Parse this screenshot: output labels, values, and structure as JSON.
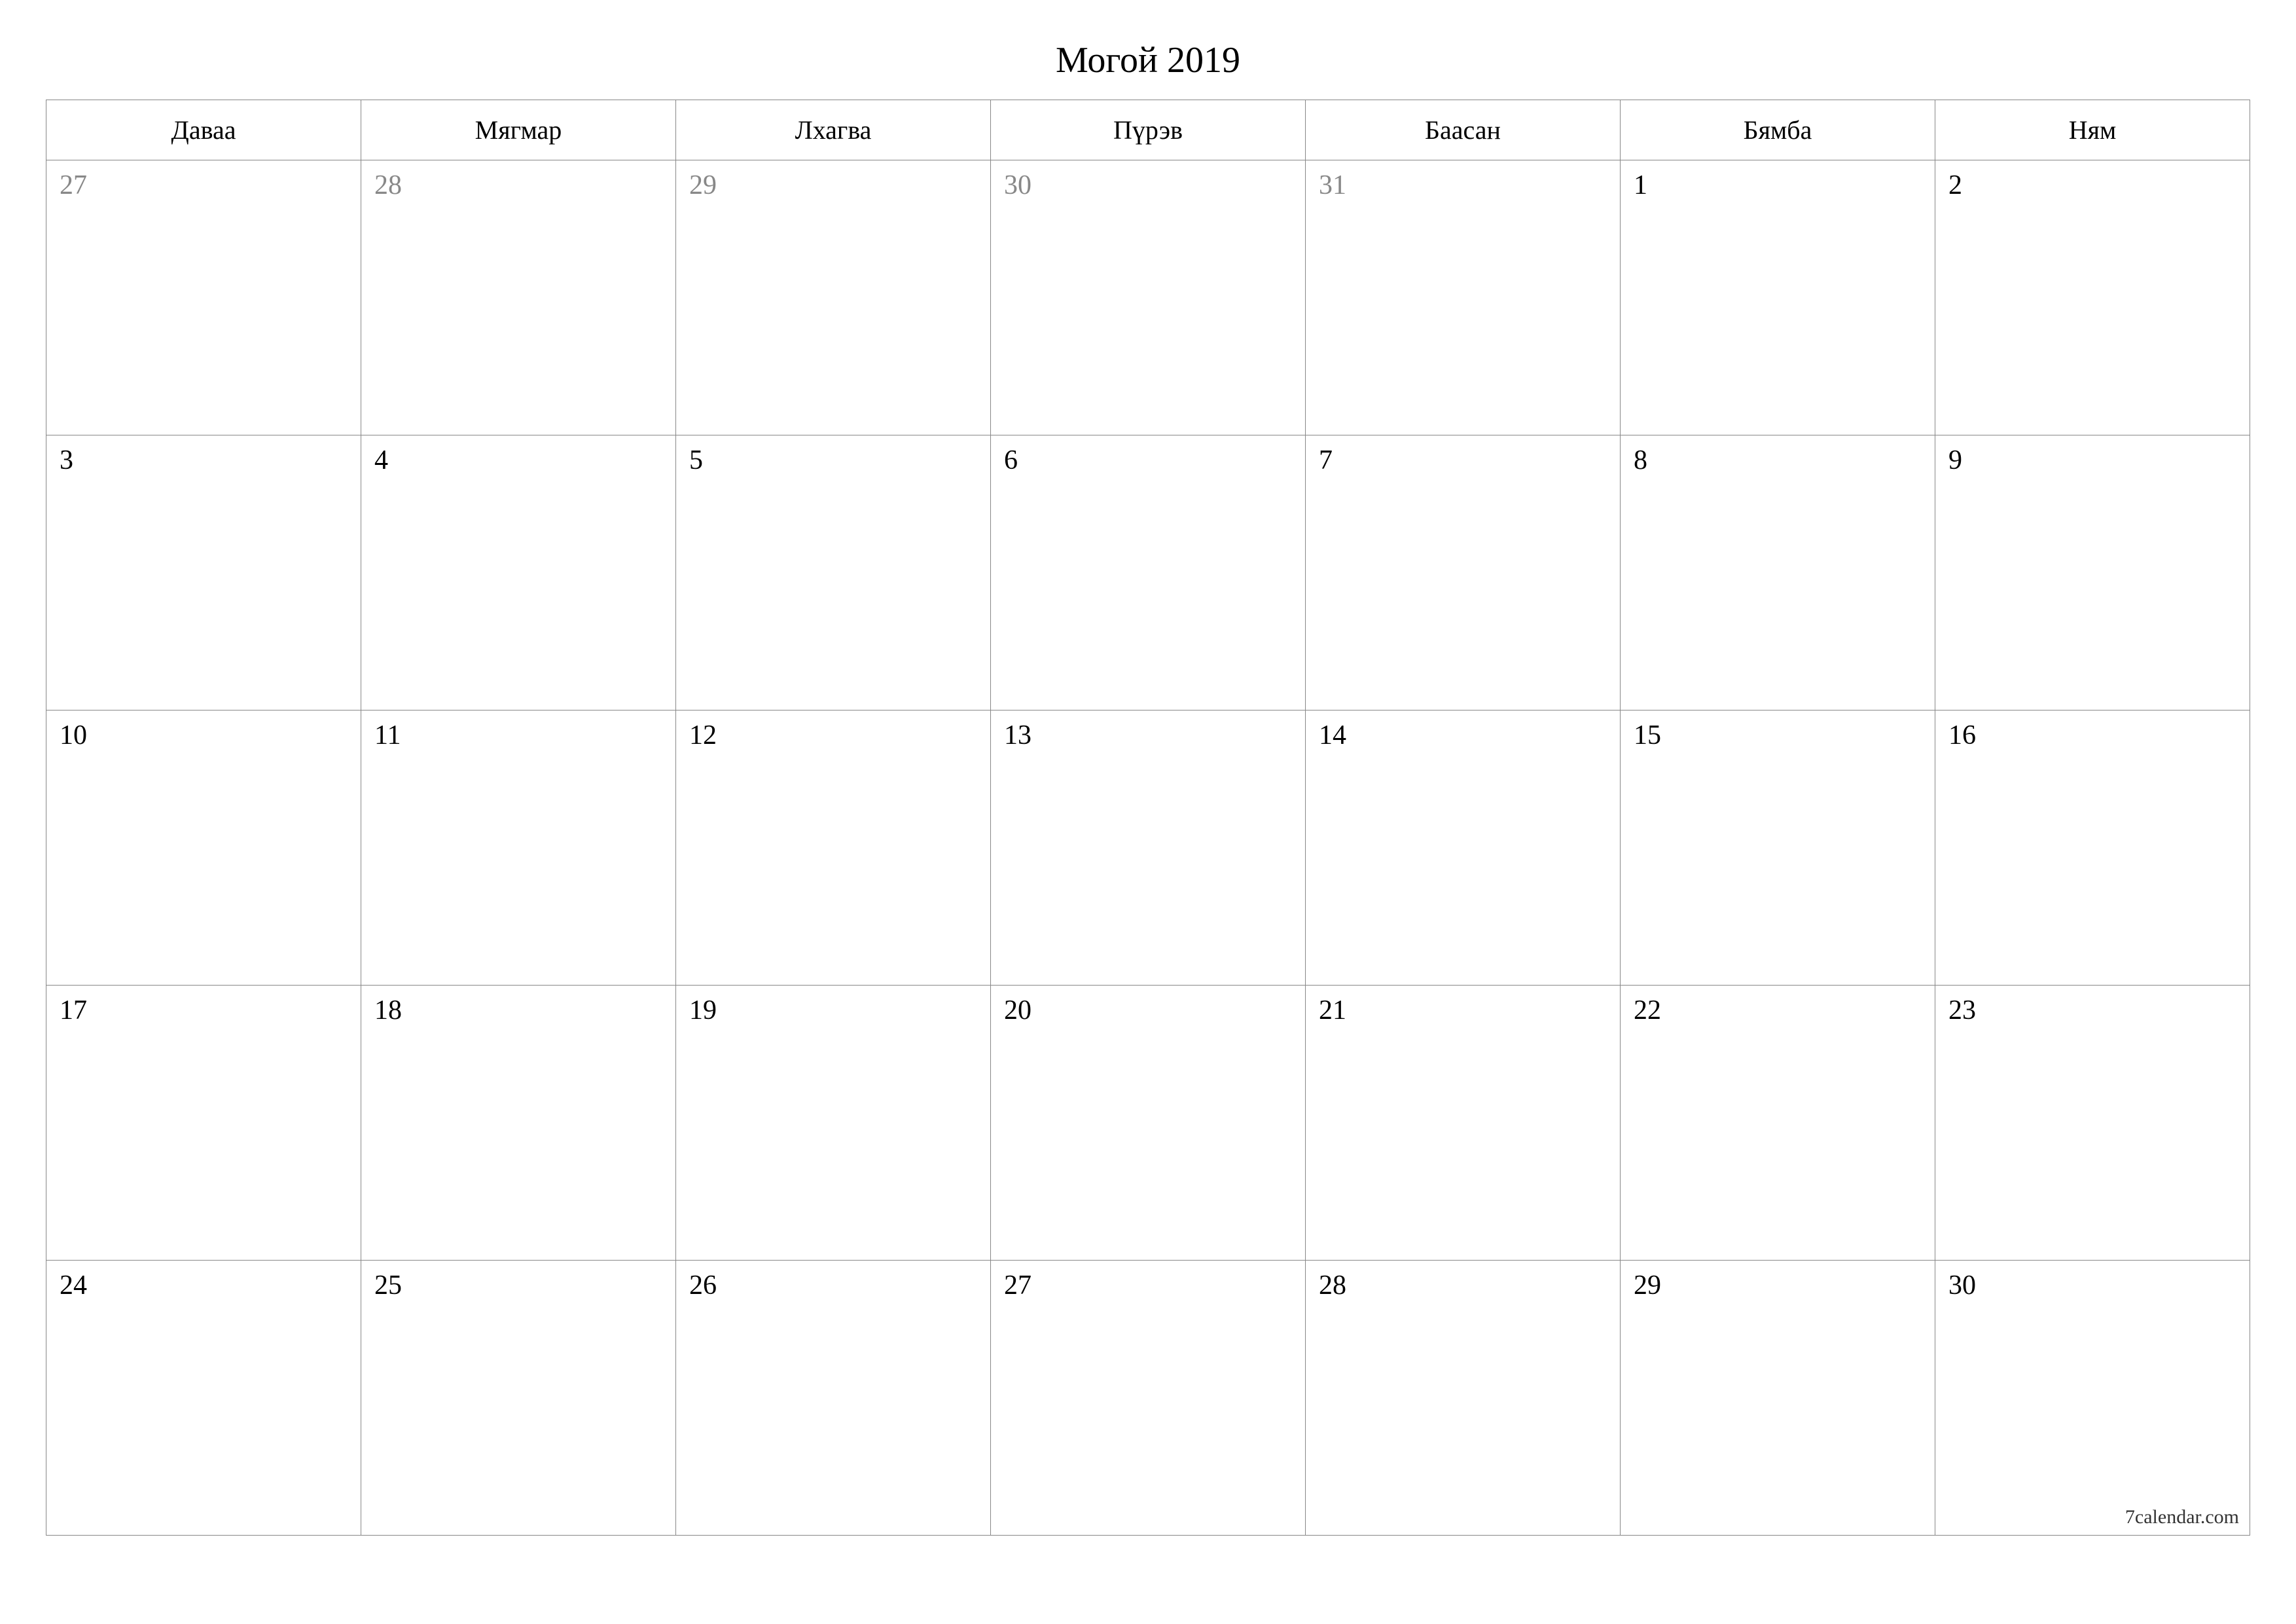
{
  "title": "Могой 2019",
  "weekdays": [
    "Даваа",
    "Мягмар",
    "Лхагва",
    "Пүрэв",
    "Баасан",
    "Бямба",
    "Ням"
  ],
  "weeks": [
    [
      {
        "n": "27",
        "other": true
      },
      {
        "n": "28",
        "other": true
      },
      {
        "n": "29",
        "other": true
      },
      {
        "n": "30",
        "other": true
      },
      {
        "n": "31",
        "other": true
      },
      {
        "n": "1",
        "other": false
      },
      {
        "n": "2",
        "other": false
      }
    ],
    [
      {
        "n": "3",
        "other": false
      },
      {
        "n": "4",
        "other": false
      },
      {
        "n": "5",
        "other": false
      },
      {
        "n": "6",
        "other": false
      },
      {
        "n": "7",
        "other": false
      },
      {
        "n": "8",
        "other": false
      },
      {
        "n": "9",
        "other": false
      }
    ],
    [
      {
        "n": "10",
        "other": false
      },
      {
        "n": "11",
        "other": false
      },
      {
        "n": "12",
        "other": false
      },
      {
        "n": "13",
        "other": false
      },
      {
        "n": "14",
        "other": false
      },
      {
        "n": "15",
        "other": false
      },
      {
        "n": "16",
        "other": false
      }
    ],
    [
      {
        "n": "17",
        "other": false
      },
      {
        "n": "18",
        "other": false
      },
      {
        "n": "19",
        "other": false
      },
      {
        "n": "20",
        "other": false
      },
      {
        "n": "21",
        "other": false
      },
      {
        "n": "22",
        "other": false
      },
      {
        "n": "23",
        "other": false
      }
    ],
    [
      {
        "n": "24",
        "other": false
      },
      {
        "n": "25",
        "other": false
      },
      {
        "n": "26",
        "other": false
      },
      {
        "n": "27",
        "other": false
      },
      {
        "n": "28",
        "other": false
      },
      {
        "n": "29",
        "other": false
      },
      {
        "n": "30",
        "other": false
      }
    ]
  ],
  "footer": "7calendar.com"
}
